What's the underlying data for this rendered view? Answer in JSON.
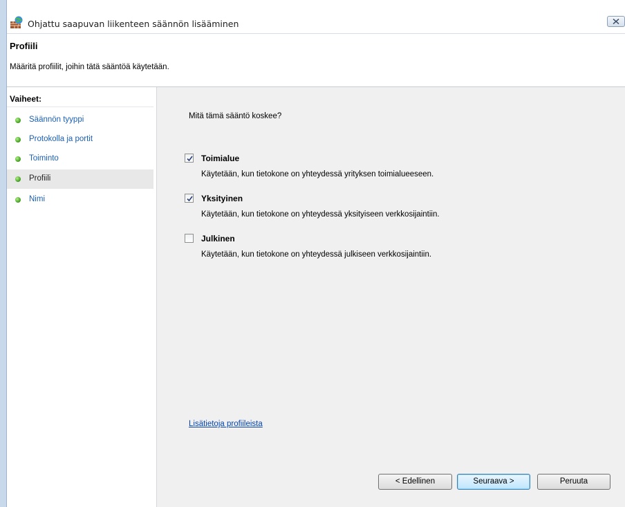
{
  "window": {
    "title": "Ohjattu saapuvan liikenteen säännön lisääminen"
  },
  "header": {
    "title": "Profiili",
    "description": "Määritä profiilit, joihin tätä sääntöä käytetään."
  },
  "sidebar": {
    "heading": "Vaiheet:",
    "steps": [
      {
        "label": "Säännön tyyppi",
        "selected": false
      },
      {
        "label": "Protokolla ja portit",
        "selected": false
      },
      {
        "label": "Toiminto",
        "selected": false
      },
      {
        "label": "Profiili",
        "selected": true
      },
      {
        "label": "Nimi",
        "selected": false
      }
    ]
  },
  "main": {
    "question": "Mitä tämä sääntö koskee?",
    "options": [
      {
        "label": "Toimialue",
        "checked": true,
        "description": "Käytetään, kun tietokone on yhteydessä yrityksen toimialueeseen."
      },
      {
        "label": "Yksityinen",
        "checked": true,
        "description": "Käytetään, kun tietokone on yhteydessä yksityiseen verkkosijaintiin."
      },
      {
        "label": "Julkinen",
        "checked": false,
        "description": "Käytetään, kun tietokone on yhteydessä julkiseen verkkosijaintiin."
      }
    ],
    "info_link": "Lisätietoja profiileista"
  },
  "buttons": {
    "back": "< Edellinen",
    "next": "Seuraava >",
    "cancel": "Peruuta"
  },
  "icons": {
    "window_icon": "firewall-icon",
    "close": "close-icon",
    "step_bullet": "green-dot-icon",
    "checkbox_check": "checkmark-icon"
  }
}
